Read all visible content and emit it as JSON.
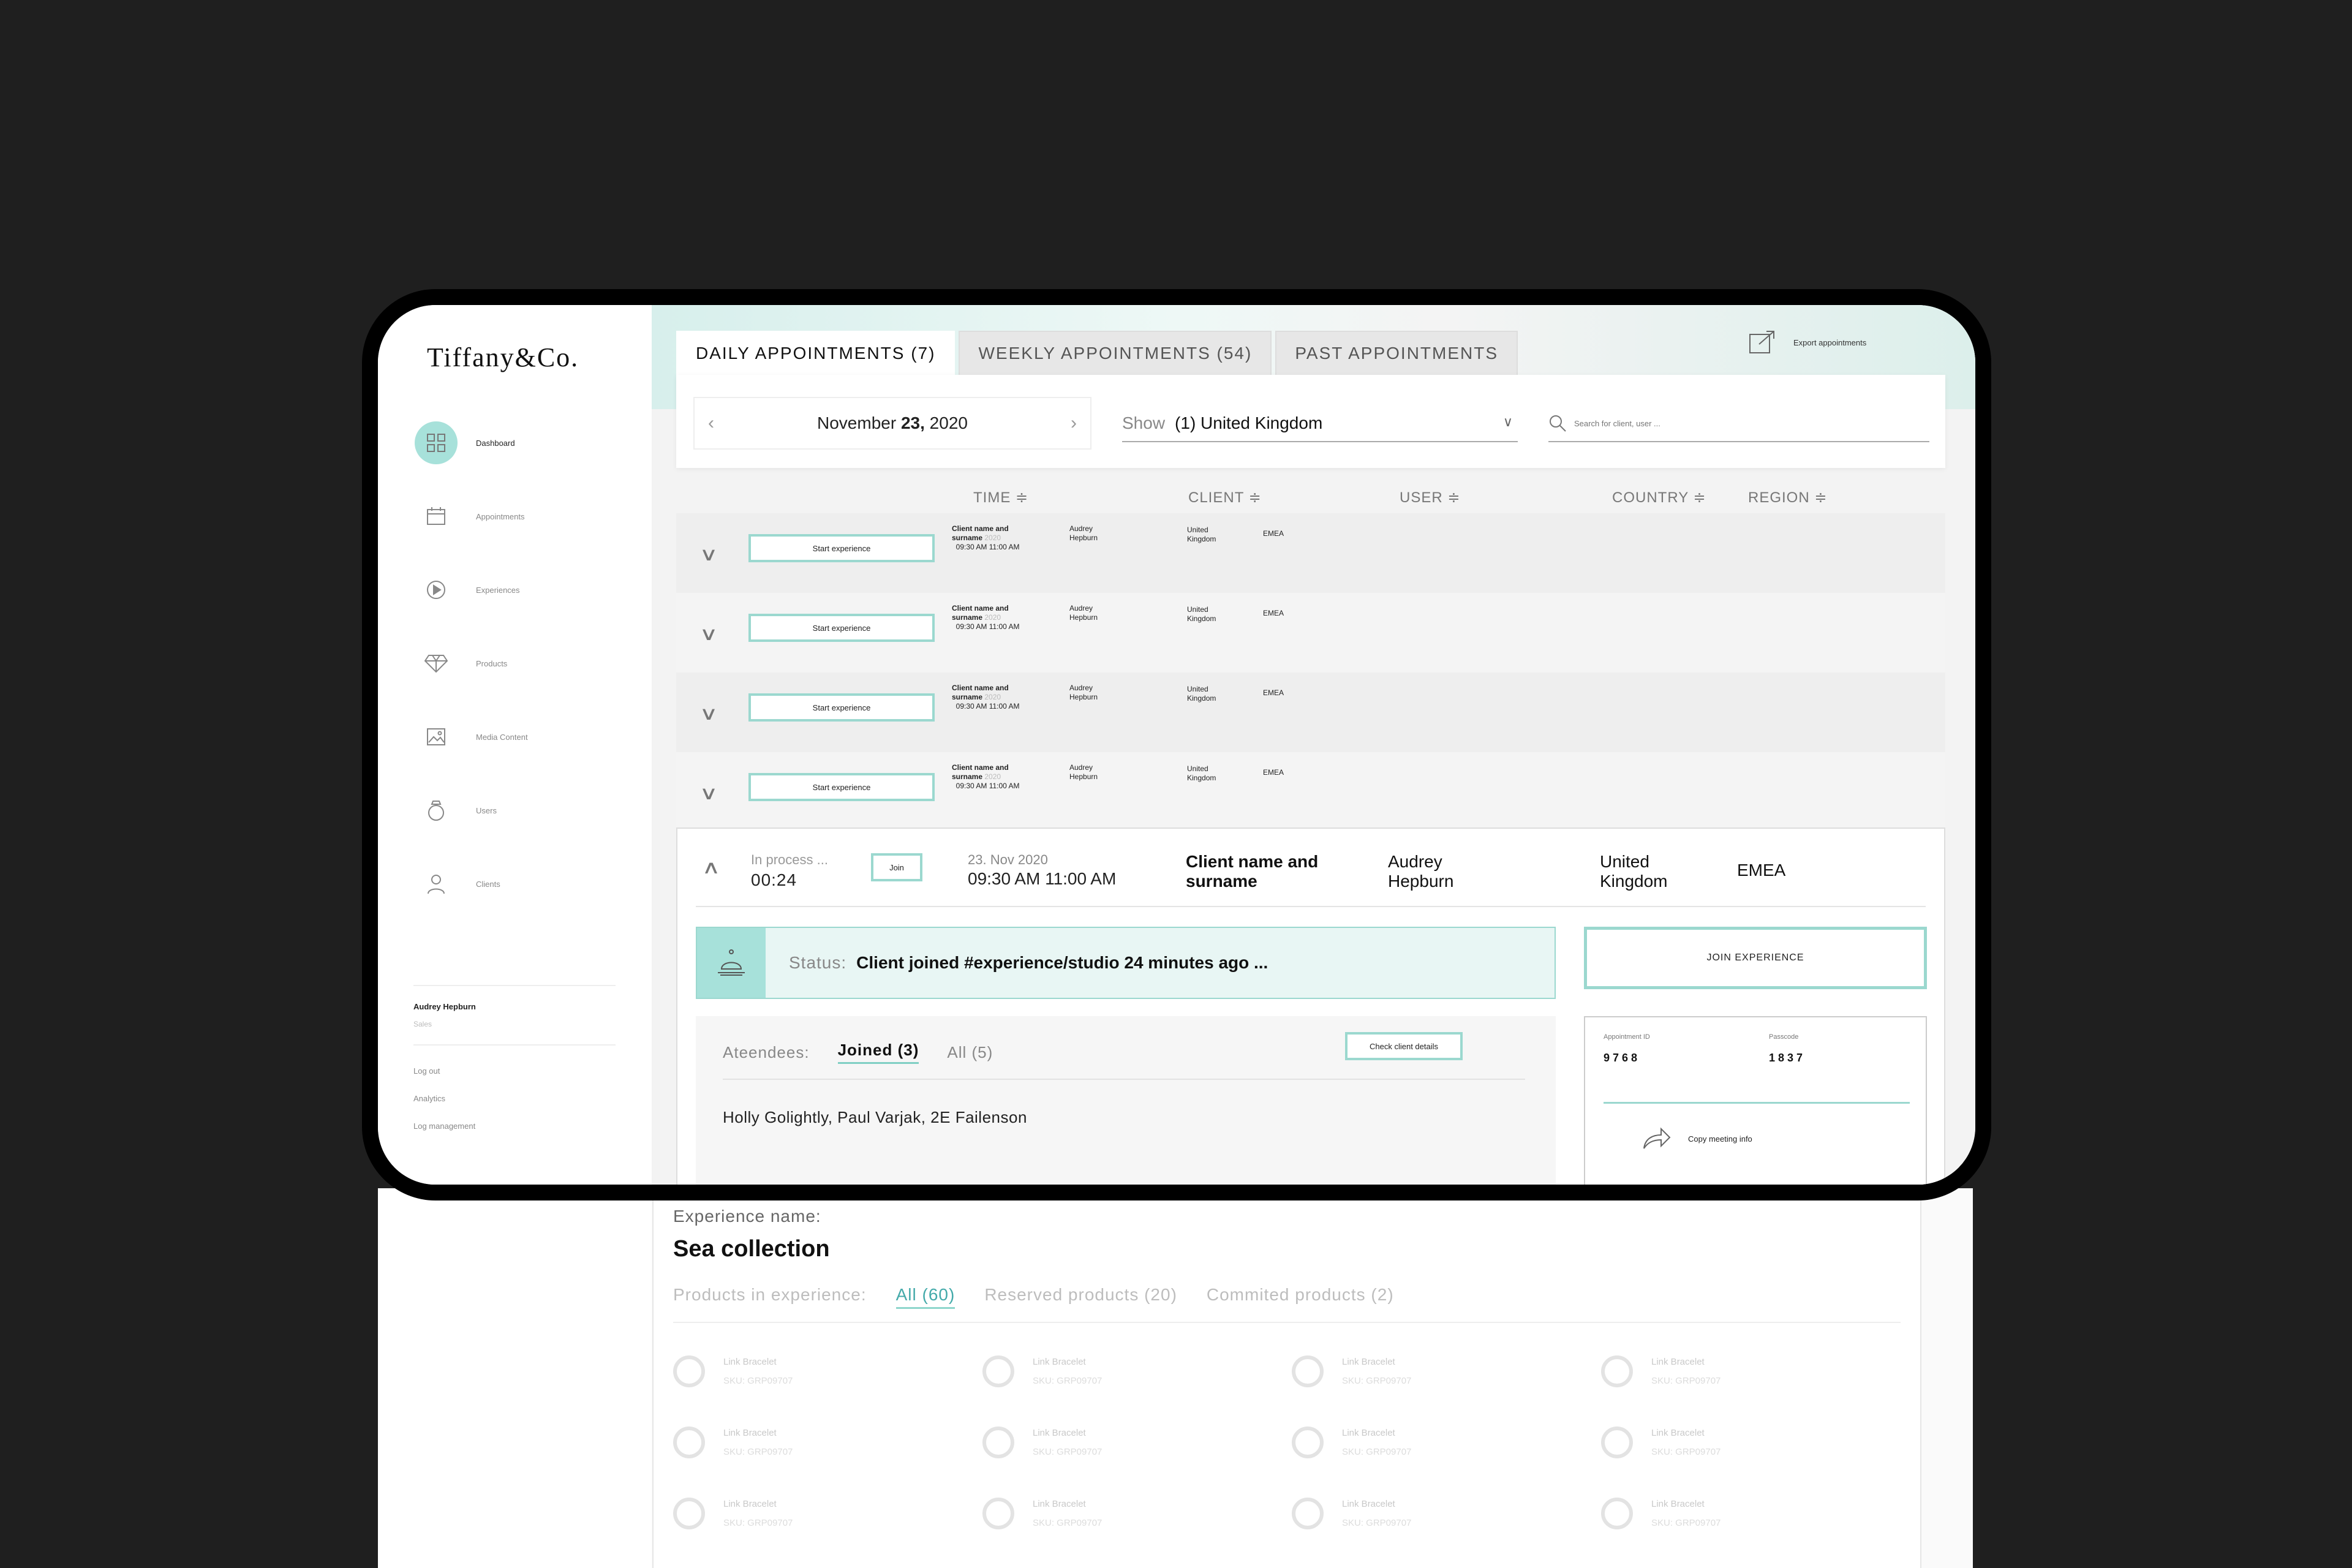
{
  "brand": {
    "logo_text": "Tiffany&Co."
  },
  "sidebar": {
    "items": [
      {
        "label": "Dashboard",
        "icon": "dashboard-icon",
        "active": true
      },
      {
        "label": "Appointments",
        "icon": "calendar-icon"
      },
      {
        "label": "Experiences",
        "icon": "play-icon"
      },
      {
        "label": "Products",
        "icon": "diamond-icon"
      },
      {
        "label": "Media Content",
        "icon": "image-icon"
      },
      {
        "label": "Users",
        "icon": "ring-icon"
      },
      {
        "label": "Clients",
        "icon": "person-icon"
      }
    ],
    "user": {
      "name": "Audrey Hepburn",
      "role": "Sales"
    },
    "links": [
      "Log out",
      "Analytics",
      "Log management"
    ]
  },
  "header": {
    "tabs": [
      "DAILY APPOINTMENTS (7)",
      "WEEKLY APPOINTMENTS (54)",
      "PAST APPOINTMENTS"
    ],
    "export_label": "Export appointments"
  },
  "filters": {
    "date_prefix": "November ",
    "date_day": "23,",
    "date_year": " 2020",
    "show_label": "Show",
    "show_value": "(1) United Kingdom",
    "search_placeholder": "Search for client, user ..."
  },
  "columns": [
    "TIME ≑",
    "CLIENT ≑",
    "USER ≑",
    "COUNTRY ≑",
    "REGION ≑"
  ],
  "rows": [
    {
      "button": "Start experience",
      "client_l1": "Client name and",
      "client_l2": "surname",
      "year": "2020",
      "time": "09:30 AM 11:00 AM",
      "user_l1": "Audrey",
      "user_l2": "Hepburn",
      "country_l1": "United",
      "country_l2": "Kingdom",
      "region": "EMEA"
    },
    {
      "button": "Start experience",
      "client_l1": "Client name and",
      "client_l2": "surname",
      "year": "2020",
      "time": "09:30 AM 11:00 AM",
      "user_l1": "Audrey",
      "user_l2": "Hepburn",
      "country_l1": "United",
      "country_l2": "Kingdom",
      "region": "EMEA"
    },
    {
      "button": "Start experience",
      "client_l1": "Client name and",
      "client_l2": "surname",
      "year": "2020",
      "time": "09:30 AM 11:00 AM",
      "user_l1": "Audrey",
      "user_l2": "Hepburn",
      "country_l1": "United",
      "country_l2": "Kingdom",
      "region": "EMEA"
    },
    {
      "button": "Start experience",
      "client_l1": "Client name and",
      "client_l2": "surname",
      "year": "2020",
      "time": "09:30 AM 11:00 AM",
      "user_l1": "Audrey",
      "user_l2": "Hepburn",
      "country_l1": "United",
      "country_l2": "Kingdom",
      "region": "EMEA"
    }
  ],
  "active_appointment": {
    "status": "In process ...",
    "timer": "00:24",
    "join_label": "Join",
    "date": "23. Nov 2020",
    "time": "09:30 AM 11:00 AM",
    "client_l1": "Client name and",
    "client_l2": "surname",
    "user_l1": "Audrey",
    "user_l2": "Hepburn",
    "country_l1": "United",
    "country_l2": "Kingdom",
    "region": "EMEA",
    "status_label": "Status:",
    "status_text": "Client joined #experience/studio 24 minutes ago ...",
    "join_experience_label": "JOIN EXPERIENCE",
    "attendees_label": "Ateendees:",
    "joined_tab": "Joined (3)",
    "all_tab": "All (5)",
    "check_client_label": "Check client details",
    "attendees": "Holly Golightly, Paul Varjak, 2E Failenson",
    "appointment_id_label": "Appointment ID",
    "appointment_id": "9768",
    "passcode_label": "Passcode",
    "passcode": "1837",
    "copy_label": "Copy meeting info"
  },
  "experience": {
    "label": "Experience name:",
    "name": "Sea collection",
    "products_label": "Products in experience:",
    "tab_all": "All (60)",
    "tab_reserved": "Reserved products (20)",
    "tab_committed": "Commited products (2)",
    "products": [
      {
        "name": "Link Bracelet",
        "sku": "SKU: GRP09707"
      },
      {
        "name": "Link Bracelet",
        "sku": "SKU: GRP09707"
      },
      {
        "name": "Link Bracelet",
        "sku": "SKU: GRP09707"
      },
      {
        "name": "Link Bracelet",
        "sku": "SKU: GRP09707"
      },
      {
        "name": "Link Bracelet",
        "sku": "SKU: GRP09707"
      },
      {
        "name": "Link Bracelet",
        "sku": "SKU: GRP09707"
      },
      {
        "name": "Link Bracelet",
        "sku": "SKU: GRP09707"
      },
      {
        "name": "Link Bracelet",
        "sku": "SKU: GRP09707"
      },
      {
        "name": "Link Bracelet",
        "sku": "SKU: GRP09707"
      },
      {
        "name": "Link Bracelet",
        "sku": "SKU: GRP09707"
      },
      {
        "name": "Link Bracelet",
        "sku": "SKU: GRP09707"
      },
      {
        "name": "Link Bracelet",
        "sku": "SKU: GRP09707"
      }
    ]
  },
  "colors": {
    "accent": "#9bd8cf",
    "accent_fill": "#a7e1da",
    "status_bg": "#e8f6f4"
  }
}
